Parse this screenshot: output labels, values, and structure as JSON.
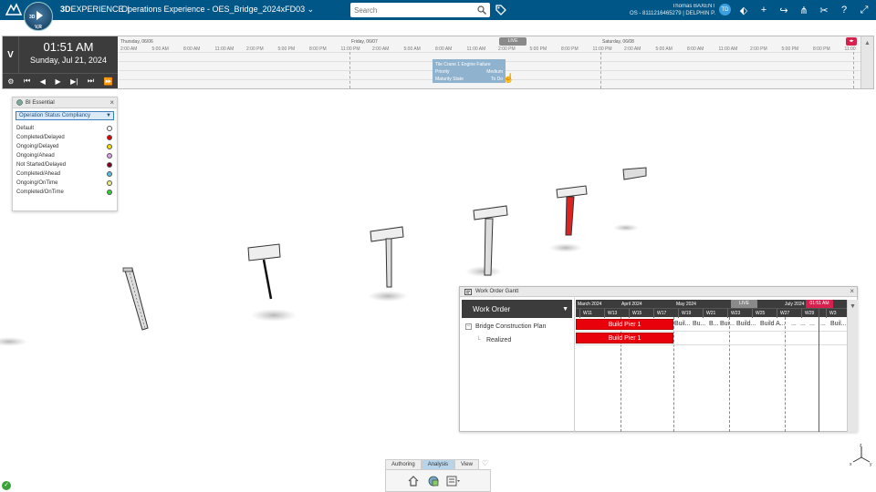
{
  "topbar": {
    "compass_labels": [
      "3D",
      "V,R"
    ],
    "brand_3d": "3D",
    "brand_rest": "EXPERIENCE",
    "separator": "|",
    "app_title": "Operations Experience - OES_Bridge_2024xFD03",
    "search_placeholder": "Search",
    "user_line1": "Thomas BAXENT",
    "user_line2": "OS - 8111216465279 | DELPHIN P.",
    "avatar_initials": "TD"
  },
  "timeline": {
    "time": "01:51 AM",
    "date": "Sunday, Jul 21, 2024",
    "collapse_label": "V",
    "day_labels": [
      "Thursday, 06/06",
      "Friday, 06/07",
      "Saturday, 06/08"
    ],
    "ticks": [
      "2:00 AM",
      "5:00 AM",
      "8:00 AM",
      "11:00 AM",
      "2:00 PM",
      "5:00 PM",
      "8:00 PM",
      "11:00 PM",
      "2:00 AM",
      "5:00 AM",
      "8:00 AM",
      "11:00 AM",
      "2:00 PM",
      "5:00 PM",
      "8:00 PM",
      "11:00 PM",
      "2:00 AM",
      "5:00 AM",
      "8:00 AM",
      "11:00 AM",
      "2:00 PM",
      "5:00 PM",
      "8:00 PM",
      "11:00"
    ],
    "live_label": "LIVE",
    "event": {
      "title": "Tile Crane 1 Engine Failure",
      "priority_label": "Priority",
      "priority_value": "Medium",
      "state_label": "Maturity State",
      "state_value": "To Do"
    }
  },
  "bi": {
    "title": "BI Essential",
    "selected": "Operation Status Compliancy",
    "legend": [
      {
        "label": "Default",
        "color": "#ffffff"
      },
      {
        "label": "Completed/Delayed",
        "color": "#e00000"
      },
      {
        "label": "Ongoing/Delayed",
        "color": "#f0e000"
      },
      {
        "label": "Ongoing/Ahead",
        "color": "#d8a0e0"
      },
      {
        "label": "Not Started/Delayed",
        "color": "#800020"
      },
      {
        "label": "Completed/Ahead",
        "color": "#50c0e0"
      },
      {
        "label": "Ongoing/OnTime",
        "color": "#e8f080"
      },
      {
        "label": "Completed/OnTime",
        "color": "#30d030"
      }
    ]
  },
  "gantt": {
    "title": "Work Order Gantt",
    "column_header": "Work Order",
    "rows": [
      "Bridge Construction Plan",
      "Realized"
    ],
    "months": [
      "March 2024",
      "April 2024",
      "May 2024",
      "July 2024"
    ],
    "weeks": [
      "W11",
      "W13",
      "W15",
      "W17",
      "W19",
      "W21",
      "W23",
      "W25",
      "W27",
      "W29",
      "W3"
    ],
    "live_label": "LIVE",
    "now_label": "01:51 AM",
    "bar_label": "Build Pier 1",
    "small_bars": [
      "Buil...",
      "Bu...",
      "B...",
      "Bui...",
      "Build...",
      "Build A...",
      "...",
      "...",
      "...",
      "...",
      "Buil..."
    ],
    "realized_bar": "Build Pier 1"
  },
  "toolbar": {
    "tabs": [
      "Authoring",
      "Analysis",
      "View"
    ],
    "active_tab": "Analysis"
  },
  "axis": {
    "x": "x",
    "y": "y",
    "z": "z"
  }
}
